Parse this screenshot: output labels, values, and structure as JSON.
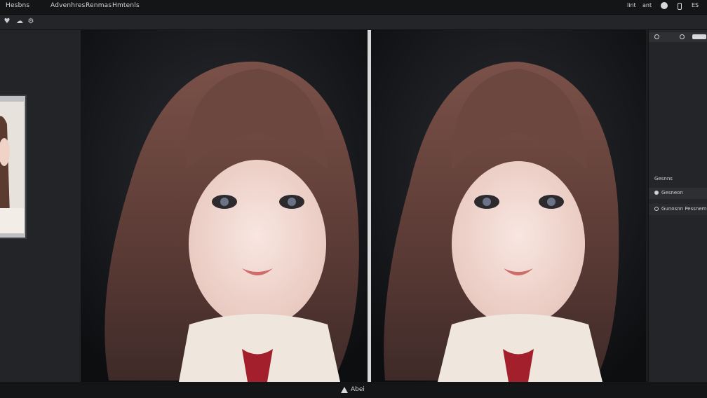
{
  "menu": {
    "items": [
      "Hesbns",
      "Advenhres",
      "Renmas",
      "Hmtenls"
    ],
    "right": [
      "lint",
      "ant",
      "ES"
    ]
  },
  "right_panel": {
    "label": "Gesnns",
    "option_1": "Gesneon",
    "option_2": "Gunosnn Pessnem"
  },
  "status": {
    "text": "Abei"
  },
  "icons": {
    "toolbar": [
      "heart-icon",
      "cloud-icon",
      "settings-icon"
    ],
    "menu_right": [
      "help-icon",
      "save-icon"
    ],
    "status": "warning-icon"
  },
  "colors": {
    "accent": "#d8d8d8",
    "panel": "#242528",
    "canvas": "#0f1012"
  }
}
